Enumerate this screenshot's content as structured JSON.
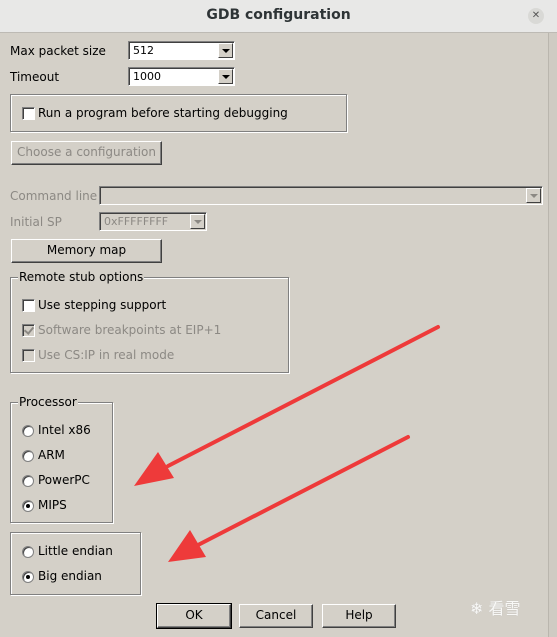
{
  "window": {
    "title": "GDB configuration",
    "close_glyph": "✕"
  },
  "max_packet_size": {
    "label": "Max packet size",
    "value": "512"
  },
  "timeout": {
    "label": "Timeout",
    "value": "1000"
  },
  "run_program": {
    "label": "Run a program before starting debugging",
    "checked": false
  },
  "choose_config": {
    "label": "Choose a configuration",
    "enabled": false
  },
  "command_line": {
    "label": "Command line",
    "value": ""
  },
  "initial_sp": {
    "label": "Initial SP",
    "value": "0xFFFFFFFF"
  },
  "memory_map": {
    "label": "Memory map"
  },
  "remote_stub": {
    "title": "Remote stub options",
    "options": [
      {
        "label": "Use stepping support",
        "checked": false,
        "enabled": true
      },
      {
        "label": "Software breakpoints at EIP+1",
        "checked": true,
        "enabled": false
      },
      {
        "label": "Use CS:IP in real mode",
        "checked": false,
        "enabled": false
      }
    ]
  },
  "processor": {
    "title": "Processor",
    "options": [
      {
        "label": "Intel x86",
        "selected": false
      },
      {
        "label": "ARM",
        "selected": false
      },
      {
        "label": "PowerPC",
        "selected": false
      },
      {
        "label": "MIPS",
        "selected": true
      }
    ]
  },
  "endian": {
    "options": [
      {
        "label": "Little endian",
        "selected": false
      },
      {
        "label": "Big endian",
        "selected": true
      }
    ]
  },
  "buttons": {
    "ok": "OK",
    "cancel": "Cancel",
    "help": "Help"
  },
  "watermark": {
    "text": "看雪"
  },
  "colors": {
    "dialog_bg": "#d4d0c8",
    "annotation_arrow": "#ee3a3a"
  },
  "icons": {
    "close": "close-icon",
    "dropdown": "chevron-down-icon",
    "watermark": "snowflake-icon"
  }
}
